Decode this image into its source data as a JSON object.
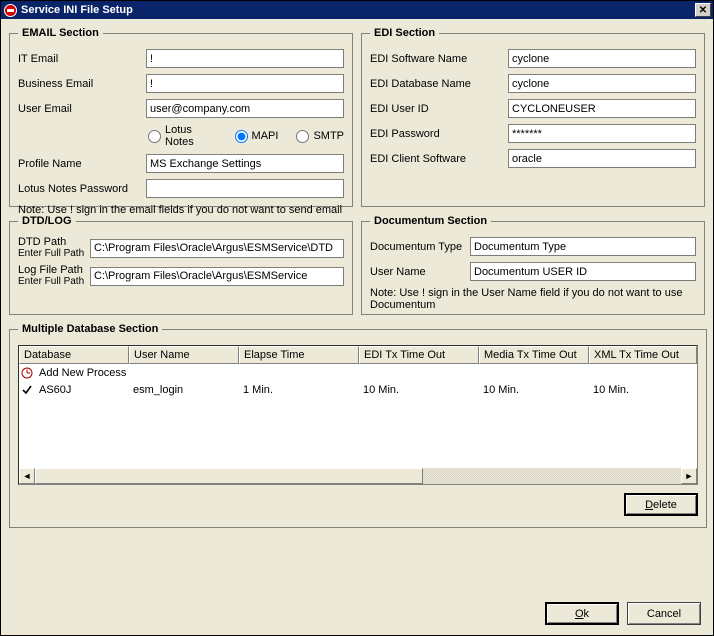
{
  "window": {
    "title": "Service INI File Setup"
  },
  "email": {
    "legend": "EMAIL Section",
    "it_label": "IT Email",
    "it_value": "!",
    "business_label": "Business Email",
    "business_value": "!",
    "user_label": "User Email",
    "user_value": "user@company.com",
    "radio_lotus": "Lotus Notes",
    "radio_mapi": "MAPI",
    "radio_smtp": "SMTP",
    "radio_selected": "MAPI",
    "profile_label": "Profile Name",
    "profile_value": "MS Exchange Settings",
    "lotus_pw_label": "Lotus Notes Password",
    "lotus_pw_value": "",
    "note": "Note: Use ! sign in the email fields if you do not want to send email"
  },
  "edi": {
    "legend": "EDI Section",
    "soft_label": "EDI Software Name",
    "soft_value": "cyclone",
    "db_label": "EDI Database Name",
    "db_value": "cyclone",
    "user_label": "EDI User ID",
    "user_value": "CYCLONEUSER",
    "pw_label": "EDI Password",
    "pw_value": "*******",
    "client_label": "EDI Client Software",
    "client_value": "oracle"
  },
  "dtd": {
    "legend": "DTD/LOG",
    "dtd_label": "DTD Path",
    "dtd_sub": "Enter Full Path",
    "dtd_value": "C:\\Program Files\\Oracle\\Argus\\ESMService\\DTD",
    "log_label": "Log File Path",
    "log_sub": "Enter Full Path",
    "log_value": "C:\\Program Files\\Oracle\\Argus\\ESMService"
  },
  "doc": {
    "legend": "Documentum Section",
    "type_label": "Documentum Type",
    "type_value": "Documentum Type",
    "user_label": "User Name",
    "user_value": "Documentum USER ID",
    "note": "Note: Use ! sign in the User Name field if you do not want to use Documentum"
  },
  "multi": {
    "legend": "Multiple Database Section",
    "columns": [
      "Database",
      "User Name",
      "Elapse Time",
      "EDI Tx Time Out",
      "Media Tx Time Out",
      "XML Tx Time Out"
    ],
    "add_new": "Add New Process",
    "rows": [
      {
        "db": "AS60J",
        "user": "esm_login",
        "elapse": "1 Min.",
        "edi": "10 Min.",
        "media": "10 Min.",
        "xml": "10 Min."
      }
    ],
    "delete": "Delete"
  },
  "buttons": {
    "ok": "Ok",
    "cancel": "Cancel"
  }
}
